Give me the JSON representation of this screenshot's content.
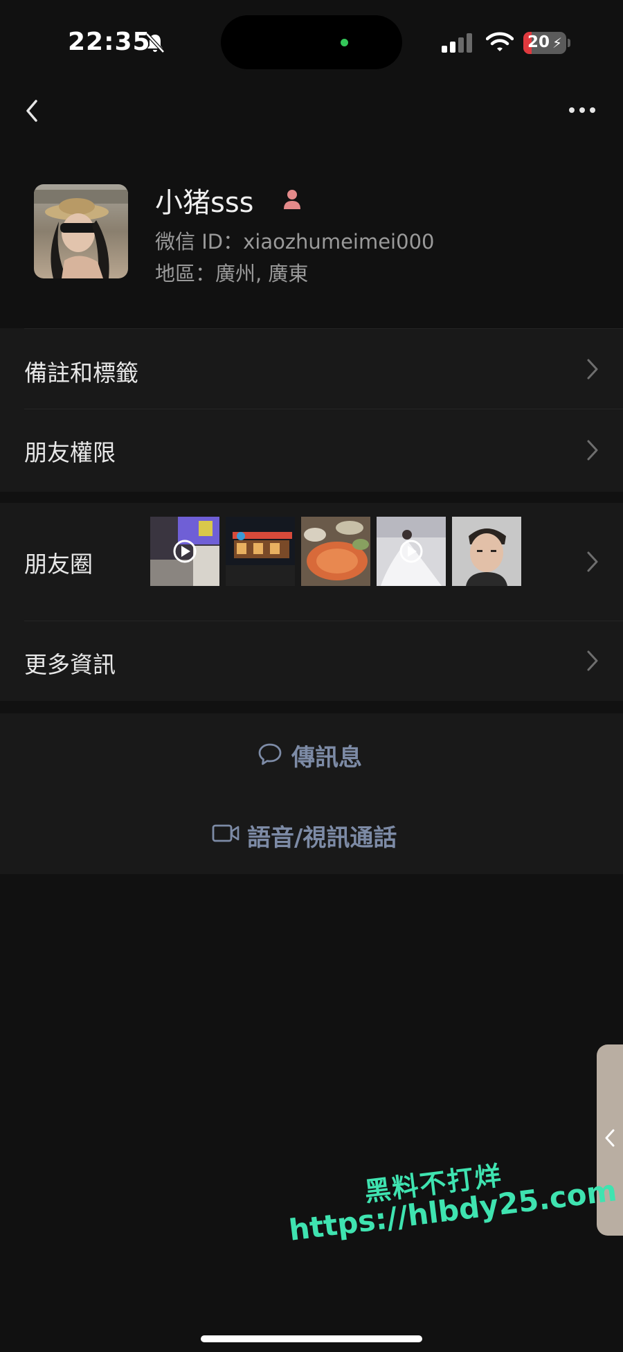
{
  "status_bar": {
    "time": "22:35",
    "battery_percent": "20",
    "battery_level": 0.2,
    "battery_color": "#e0393e",
    "signal_bars_active": 2,
    "icons": [
      "bell-slash-icon",
      "cellular-signal-icon",
      "wifi-icon",
      "battery-icon",
      "bolt-icon"
    ]
  },
  "nav": {
    "back_icon": "chevron-left-icon",
    "more_icon": "ellipsis-icon"
  },
  "profile": {
    "name": "小猪sss",
    "gender_icon": "female-icon",
    "wechat_id": "微信 ID：xiaozhumeimei000",
    "region": "地區：廣州, 廣東"
  },
  "rows": {
    "remarks_tags": "備註和標籤",
    "friend_permissions": "朋友權限",
    "moments": "朋友圈",
    "more_info": "更多資訊"
  },
  "moments_thumbnails": [
    {
      "name": "moments-thumb-1",
      "is_video": true
    },
    {
      "name": "moments-thumb-2",
      "is_video": false
    },
    {
      "name": "moments-thumb-3",
      "is_video": false
    },
    {
      "name": "moments-thumb-4",
      "is_video": true
    },
    {
      "name": "moments-thumb-5",
      "is_video": false
    }
  ],
  "actions": {
    "send_message": "傳訊息",
    "voice_video_call": "語音/視訊通話"
  },
  "watermark": {
    "line1": "黑料不打烊",
    "line2": "https://hlbdy25.com"
  },
  "colors": {
    "background": "#111111",
    "card": "#191919",
    "action_text": "#7d8ba6",
    "watermark": "#3fe3b0"
  }
}
